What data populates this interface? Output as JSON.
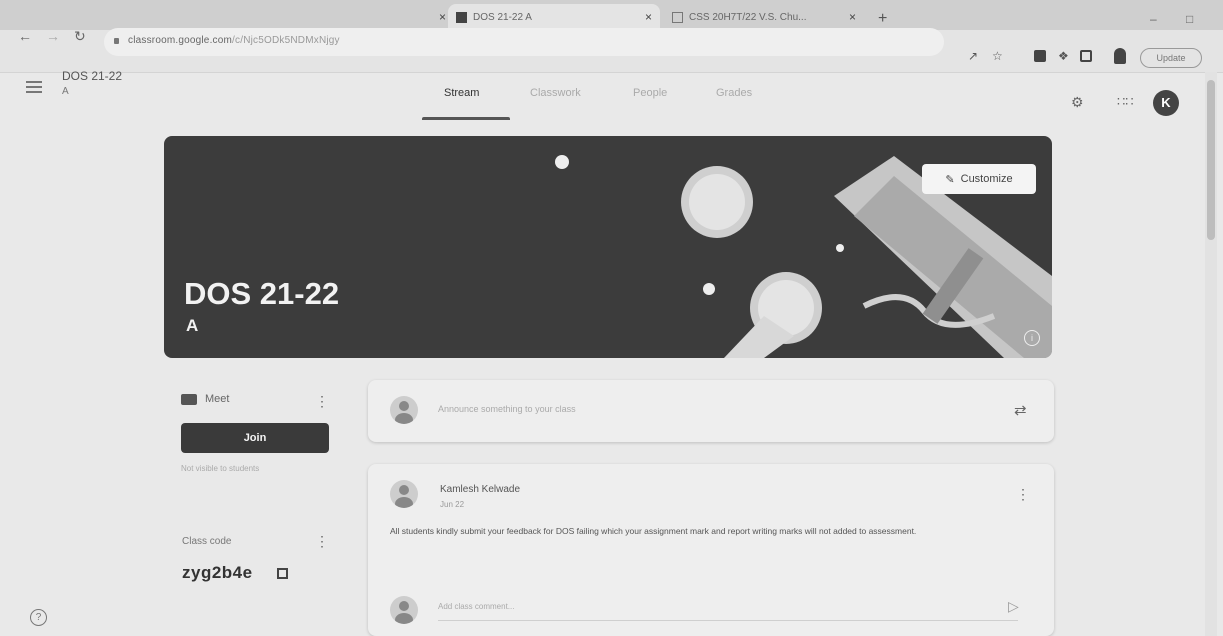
{
  "browser": {
    "tabs": [
      {
        "title": "",
        "active": false
      },
      {
        "title": "DOS 21-22 A",
        "active": true
      },
      {
        "title": "CSS 20H7T/22 V.S. Chu...",
        "active": false
      }
    ],
    "close_glyph": "×",
    "new_tab_glyph": "+",
    "url_host": "classroom.google.com",
    "url_path": "/c/Njc5ODk5NDMxNjgy",
    "update_label": "Update",
    "icons": [
      "back-icon",
      "forward-icon",
      "reload-icon",
      "share-icon",
      "star-icon",
      "extension-icon",
      "puzzle-icon",
      "sidepanel-icon",
      "profile-icon"
    ]
  },
  "header": {
    "class_title": "DOS 21-22",
    "class_section": "A",
    "tabs": [
      "Stream",
      "Classwork",
      "People",
      "Grades"
    ],
    "active_tab": "Stream",
    "avatar_letter": "K",
    "icons": [
      "menu-icon",
      "settings-icon",
      "apps-grid-icon"
    ]
  },
  "banner": {
    "title": "DOS 21-22",
    "section": "A",
    "customize_label": "Customize"
  },
  "meet": {
    "label": "Meet",
    "join_label": "Join",
    "note": "Not visible to students"
  },
  "class_code": {
    "label": "Class code",
    "value": "zyg2b4e"
  },
  "stream": {
    "announce_placeholder": "Announce something to your class",
    "post": {
      "author": "Kamlesh Kelwade",
      "date": "Jun 22",
      "body": "All students kindly submit your feedback for DOS failing which your assignment mark and report writing marks will not added to assessment.",
      "comment_placeholder": "Add class comment..."
    }
  },
  "colors": {
    "banner_bg": "#3c3c3c",
    "join_bg": "#3a3a3a",
    "page_bg": "#e9e9e9"
  }
}
